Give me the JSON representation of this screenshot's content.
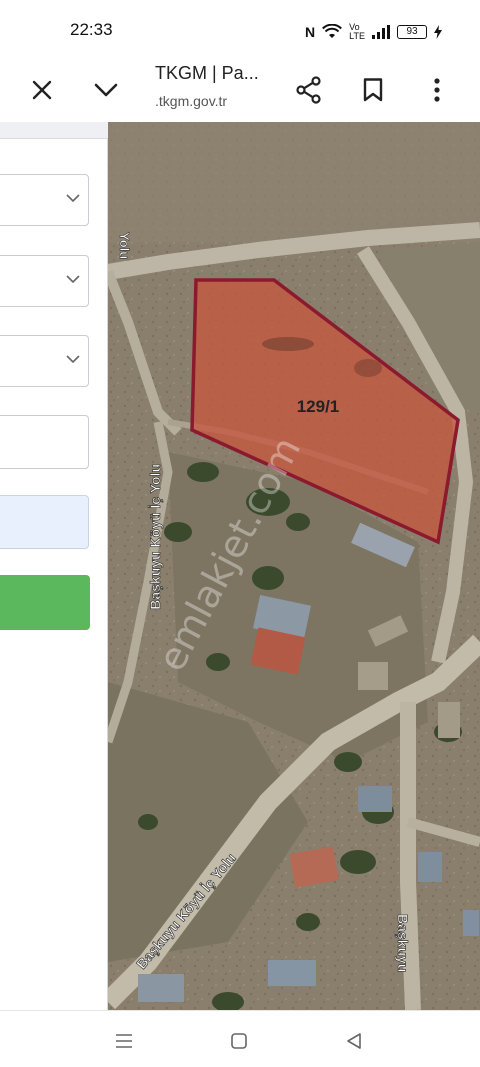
{
  "status": {
    "time": "22:33",
    "battery": "93"
  },
  "browser": {
    "tab_title": "TKGM | Pa...",
    "url": ".tkgm.gov.tr"
  },
  "map": {
    "parcel_label": "129/1",
    "roads": [
      "Başkuyu Köyü İç Yolu",
      "Başkuyu Köyü İç Yolu",
      "Başkuyu"
    ],
    "road_fragment": "Yolu",
    "watermark": "emlakjet.com",
    "parcel_color": "#8b1a2e"
  },
  "panel": {
    "selects": [
      "",
      "",
      ""
    ],
    "inputs": [
      "",
      ""
    ],
    "button_color": "#5cb85c"
  },
  "icons": {
    "close": "close-icon",
    "collapse": "chevron-down-icon",
    "share": "share-icon",
    "bookmark": "bookmark-icon",
    "menu": "more-vert-icon",
    "nav_recents": "menu-icon",
    "nav_home": "home-icon",
    "nav_back": "back-icon"
  }
}
